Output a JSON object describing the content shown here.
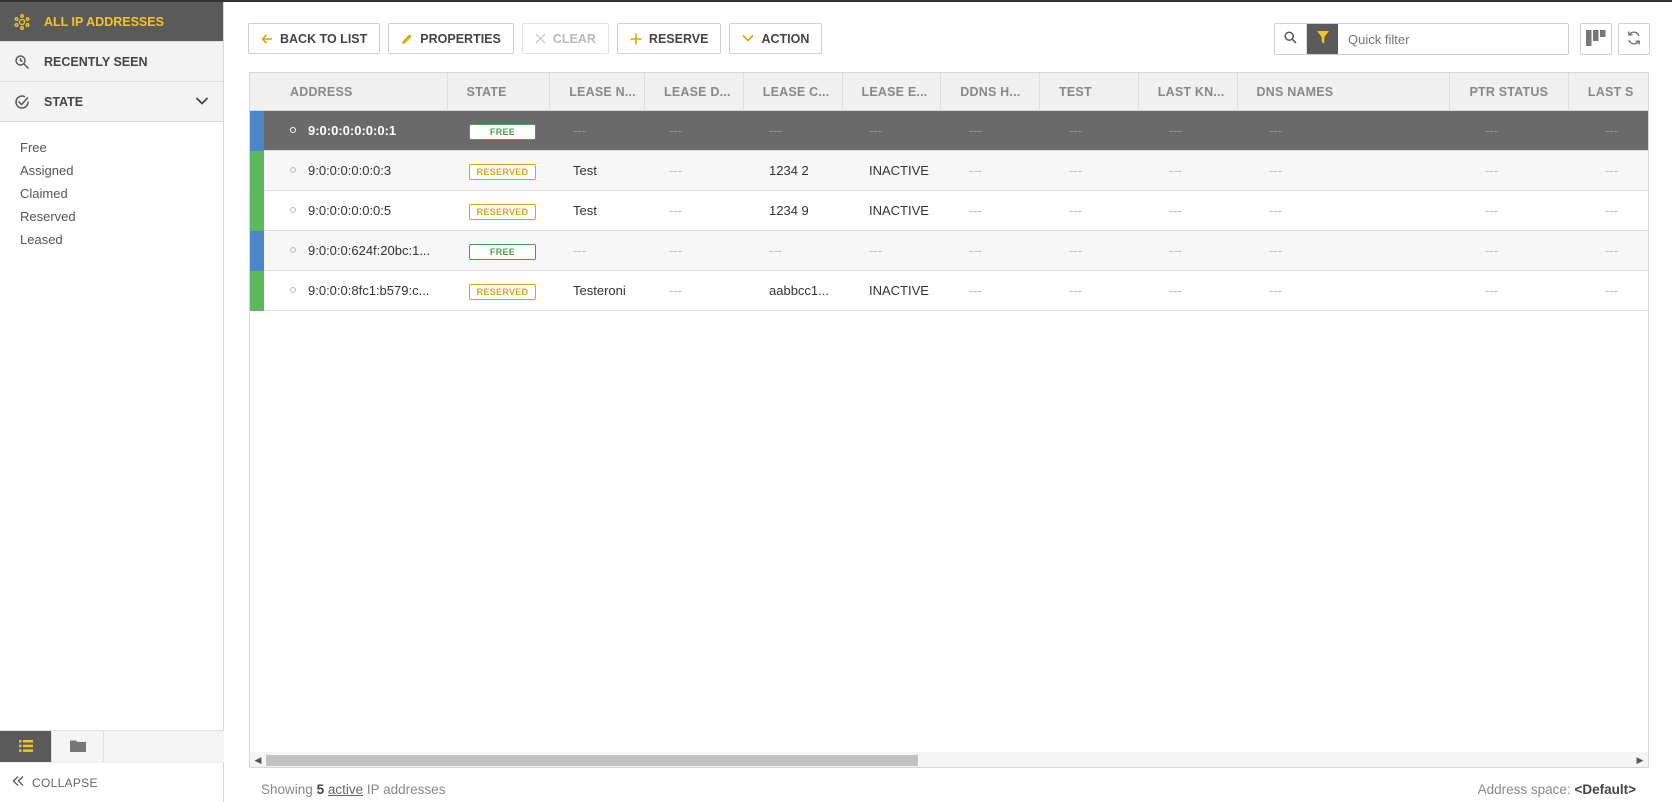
{
  "sidebar": {
    "items": [
      {
        "label": "ALL IP ADDRESSES",
        "icon": "network-icon",
        "active": true
      },
      {
        "label": "RECENTLY SEEN",
        "icon": "search-history-icon"
      },
      {
        "label": "STATE",
        "icon": "check-circle-icon"
      }
    ],
    "states": [
      "Free",
      "Assigned",
      "Claimed",
      "Reserved",
      "Leased"
    ],
    "collapse_label": "COLLAPSE"
  },
  "toolbar": {
    "back": "BACK TO LIST",
    "properties": "PROPERTIES",
    "clear": "CLEAR",
    "reserve": "RESERVE",
    "action": "ACTION"
  },
  "filter": {
    "placeholder": "Quick filter"
  },
  "table": {
    "columns": [
      "ADDRESS",
      "STATE",
      "LEASE N...",
      "LEASE D...",
      "LEASE C...",
      "LEASE E...",
      "DDNS H...",
      "TEST",
      "LAST KN...",
      "DNS NAMES",
      "PTR STATUS",
      "LAST S"
    ],
    "rows": [
      {
        "address": "9:0:0:0:0:0:0:1",
        "state": "FREE",
        "lease_name": "---",
        "lease_d": "---",
        "lease_c": "---",
        "lease_e": "---",
        "ddns": "---",
        "test": "---",
        "last_kn": "---",
        "dns": "---",
        "ptr": "---",
        "last_s": "---",
        "bar": "#4a86c8"
      },
      {
        "address": "9:0:0:0:0:0:0:3",
        "state": "RESERVED",
        "lease_name": "Test",
        "lease_d": "---",
        "lease_c": "1234 2",
        "lease_e": "INACTIVE",
        "ddns": "---",
        "test": "---",
        "last_kn": "---",
        "dns": "---",
        "ptr": "---",
        "last_s": "---",
        "bar": "#5cb85c"
      },
      {
        "address": "9:0:0:0:0:0:0:5",
        "state": "RESERVED",
        "lease_name": "Test",
        "lease_d": "---",
        "lease_c": "1234 9",
        "lease_e": "INACTIVE",
        "ddns": "---",
        "test": "---",
        "last_kn": "---",
        "dns": "---",
        "ptr": "---",
        "last_s": "---",
        "bar": "#5cb85c"
      },
      {
        "address": "9:0:0:0:624f:20bc:1...",
        "state": "FREE",
        "lease_name": "---",
        "lease_d": "---",
        "lease_c": "---",
        "lease_e": "---",
        "ddns": "---",
        "test": "---",
        "last_kn": "---",
        "dns": "---",
        "ptr": "---",
        "last_s": "---",
        "bar": "#4a86c8"
      },
      {
        "address": "9:0:0:0:8fc1:b579:c...",
        "state": "RESERVED",
        "lease_name": "Testeroni",
        "lease_d": "---",
        "lease_c": "aabbcc1...",
        "lease_e": "INACTIVE",
        "ddns": "---",
        "test": "---",
        "last_kn": "---",
        "dns": "---",
        "ptr": "---",
        "last_s": "---",
        "bar": "#5cb85c"
      }
    ]
  },
  "status": {
    "prefix": "Showing",
    "count": "5",
    "active": "active",
    "suffix": "IP addresses",
    "space_label": "Address space:",
    "space_value": "<Default>"
  }
}
